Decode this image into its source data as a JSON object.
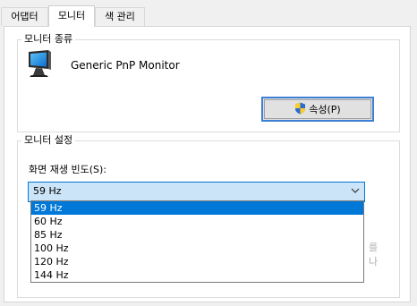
{
  "tabs": [
    {
      "label": "어댑터"
    },
    {
      "label": "모니터"
    },
    {
      "label": "색 관리"
    }
  ],
  "monitor_type": {
    "group_title": "모니터 종류",
    "monitor_name": "Generic PnP Monitor",
    "properties_button": "속성(P)",
    "icon": "monitor-icon"
  },
  "monitor_settings": {
    "group_title": "모니터 설정",
    "refresh_label": "화면 재생 빈도(S):",
    "refresh_selected": "59 Hz",
    "refresh_options": [
      "59 Hz",
      "60 Hz",
      "85 Hz",
      "100 Hz",
      "120 Hz",
      "144 Hz"
    ],
    "selected_index": 0,
    "hidden_text": "를\n나"
  },
  "colors": {
    "accent": "#0078d7",
    "select_bg": "#cce4f7"
  }
}
